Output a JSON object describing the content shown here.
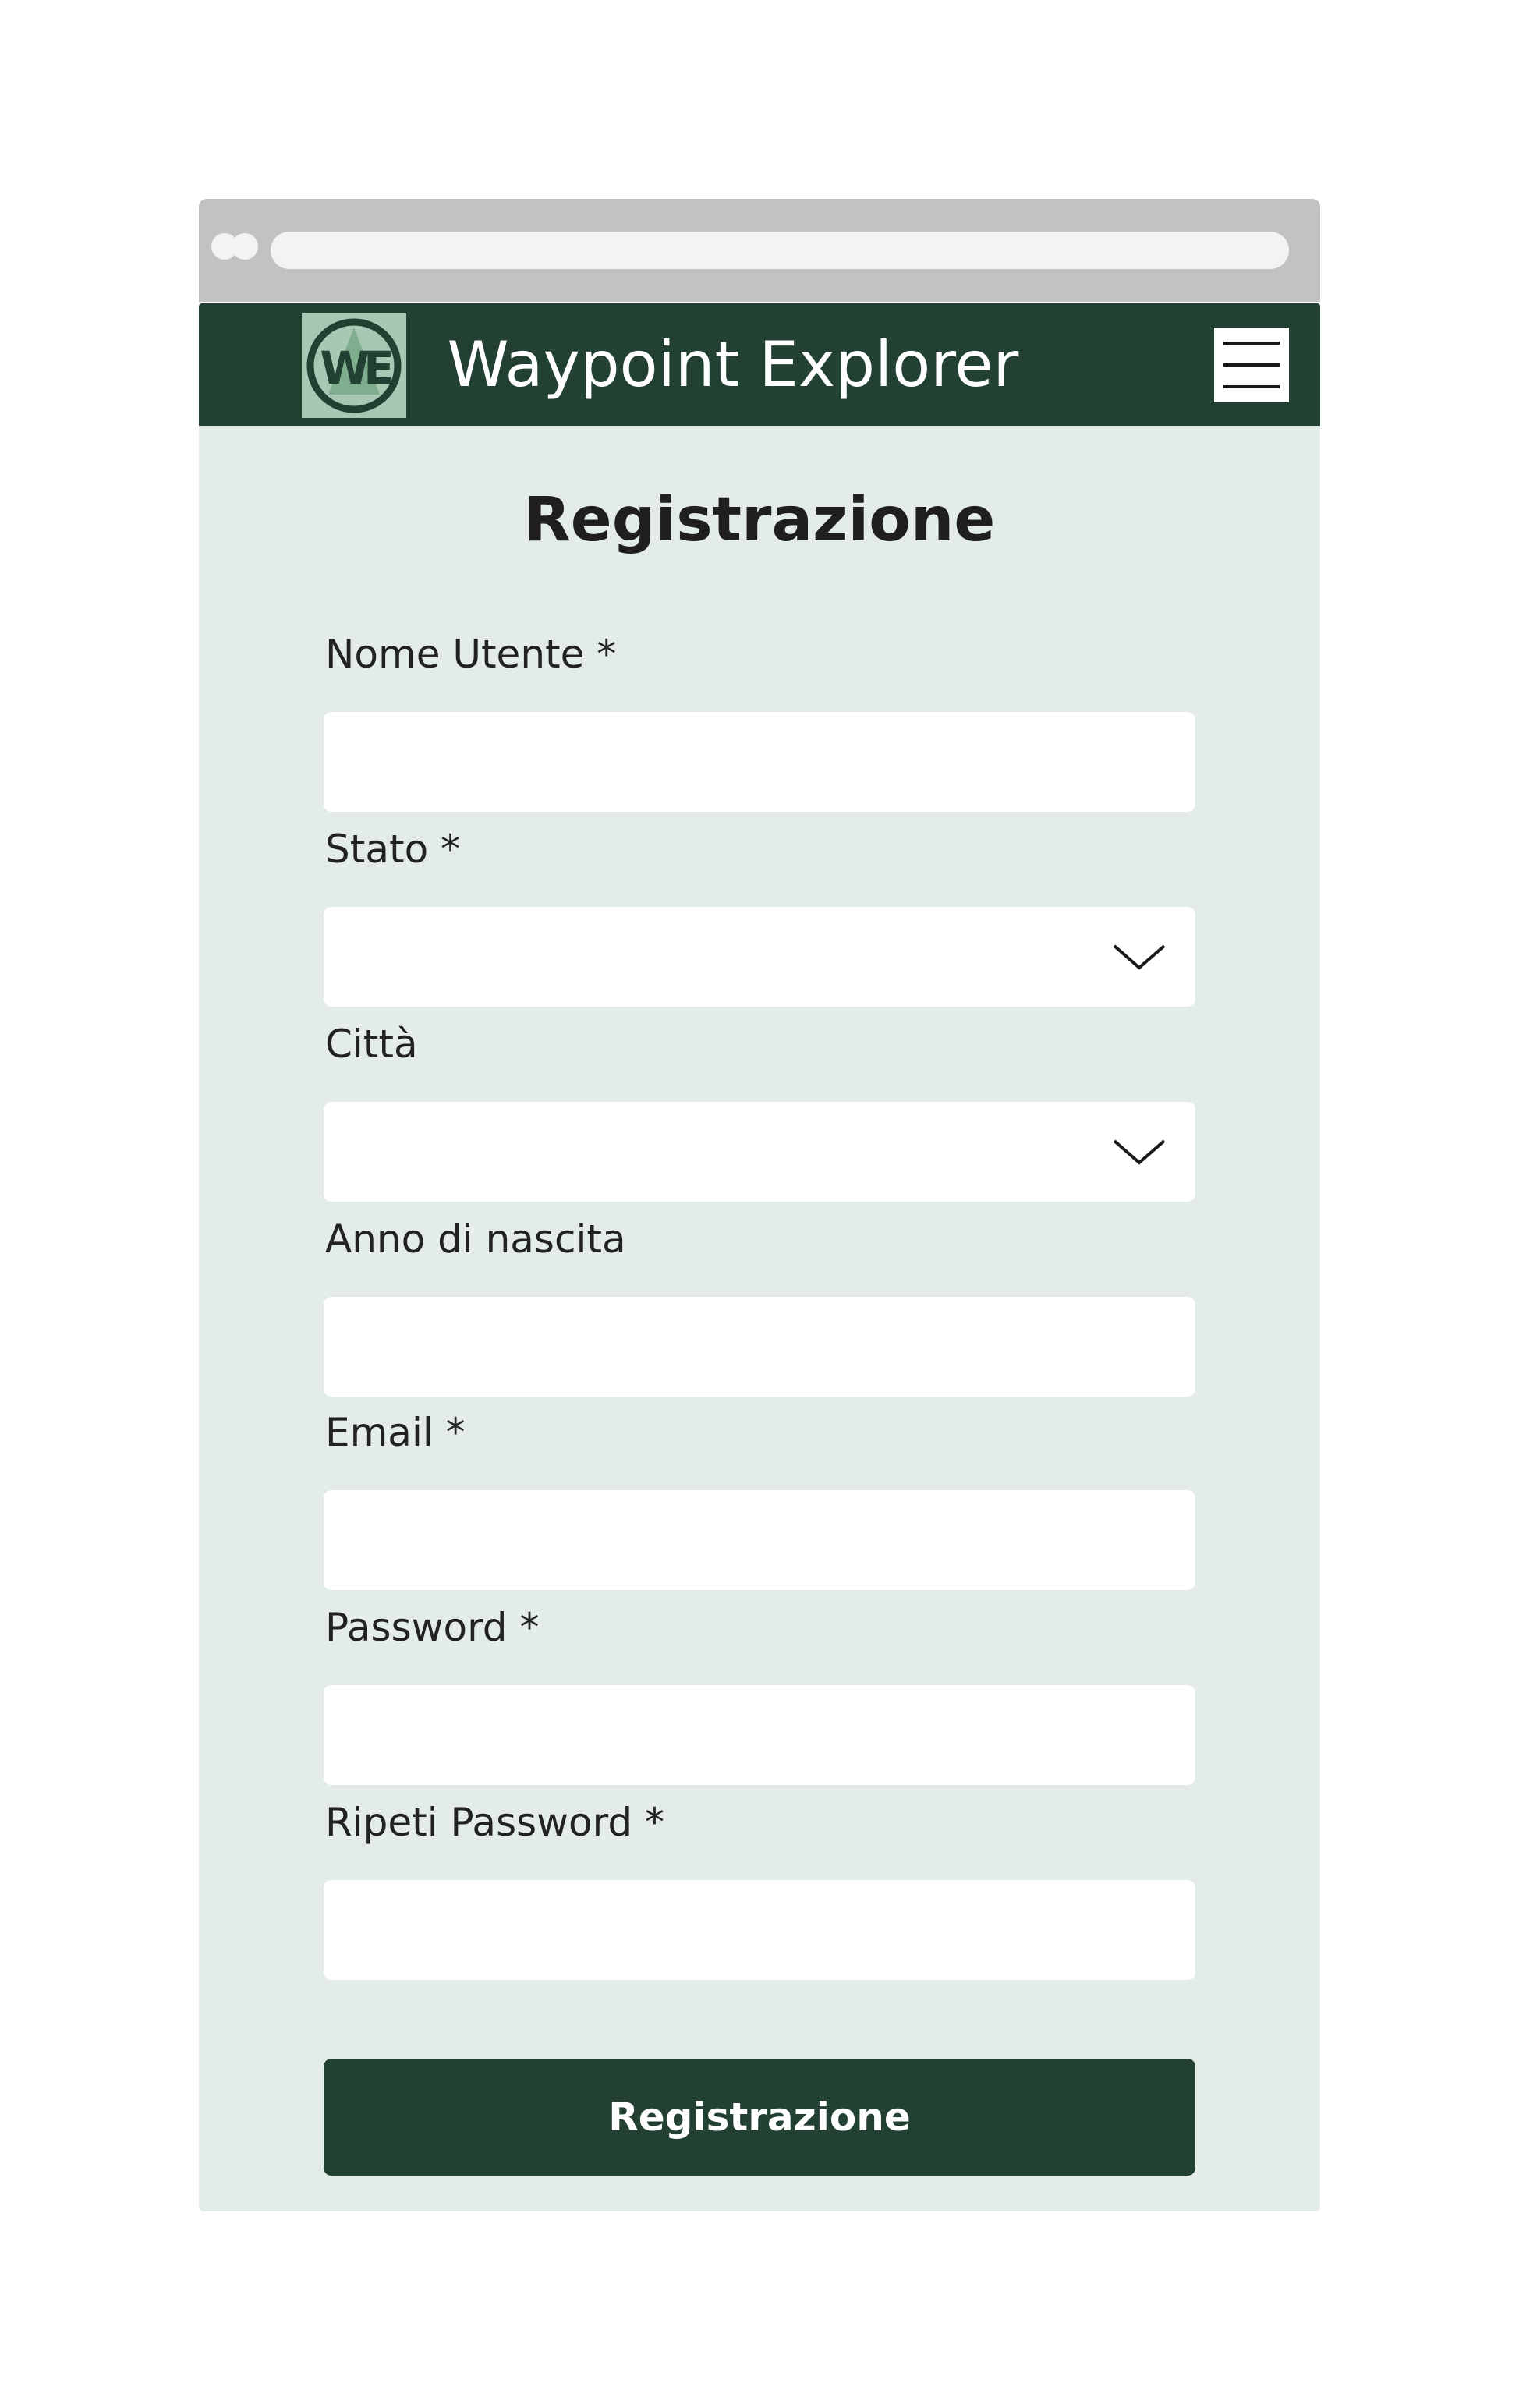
{
  "header": {
    "title": "Waypoint Explorer",
    "logo_text": "WE",
    "menu_icon": "hamburger-menu-icon"
  },
  "form": {
    "title": "Registrazione",
    "fields": [
      {
        "label": "Nome Utente *",
        "type": "text",
        "value": ""
      },
      {
        "label": "Stato *",
        "type": "select",
        "value": ""
      },
      {
        "label": "Città",
        "type": "select",
        "value": ""
      },
      {
        "label": "Anno di nascita",
        "type": "text",
        "value": ""
      },
      {
        "label": "Email *",
        "type": "text",
        "value": ""
      },
      {
        "label": "Password *",
        "type": "password",
        "value": ""
      },
      {
        "label": "Ripeti Password *",
        "type": "password",
        "value": ""
      }
    ],
    "submit_label": "Registrazione"
  },
  "colors": {
    "header_bg": "#224132",
    "content_bg": "#e3ece6",
    "browser_bar": "#c2c2c2",
    "button_bg": "#224132",
    "logo_bg": "#a8c8b4"
  }
}
